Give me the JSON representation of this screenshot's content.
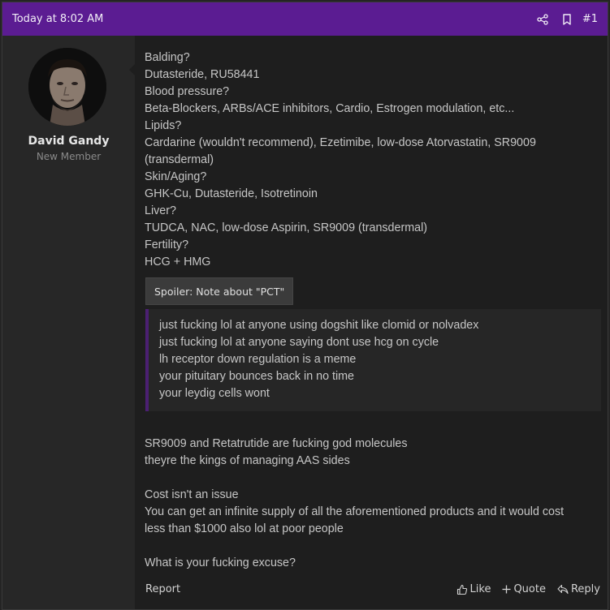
{
  "header": {
    "timestamp": "Today at 8:02 AM",
    "share_icon": "share-icon",
    "bookmark_icon": "bookmark-icon",
    "post_number": "#1",
    "bar_color": "#5b1c92"
  },
  "user": {
    "name": "David Gandy",
    "title": "New Member",
    "avatar_icon": "avatar"
  },
  "body": {
    "lines": [
      "Balding?",
      "Dutasteride, RU58441",
      "Blood pressure?",
      "Beta-Blockers, ARBs/ACE inhibitors, Cardio, Estrogen modulation, etc...",
      "Lipids?",
      "Cardarine (wouldn't recommend), Ezetimibe, low-dose Atorvastatin, SR9009",
      "(transdermal)",
      "Skin/Aging?",
      "GHK-Cu, Dutasteride, Isotretinoin",
      "Liver?",
      "TUDCA, NAC, low-dose Aspirin, SR9009 (transdermal)",
      "Fertility?",
      "HCG + HMG"
    ],
    "spoiler_label": "Spoiler: Note about \"PCT\"",
    "spoiler_lines": [
      "just fucking lol at anyone using dogshit like clomid or nolvadex",
      "just fucking lol at anyone saying dont use hcg on cycle",
      "lh receptor down regulation is a meme",
      "your pituitary bounces back in no time",
      "your leydig cells wont"
    ],
    "lines2": [
      "SR9009 and Retatrutide are fucking god molecules",
      "theyre the kings of managing AAS sides"
    ],
    "lines3": [
      "Cost isn't an issue",
      "You can get an infinite supply of all the aforementioned products and it would cost",
      "less than $1000 also lol at poor people"
    ],
    "lines4": [
      "What is your fucking excuse?"
    ]
  },
  "footer": {
    "report": "Report",
    "like": "Like",
    "quote": "Quote",
    "reply": "Reply"
  }
}
